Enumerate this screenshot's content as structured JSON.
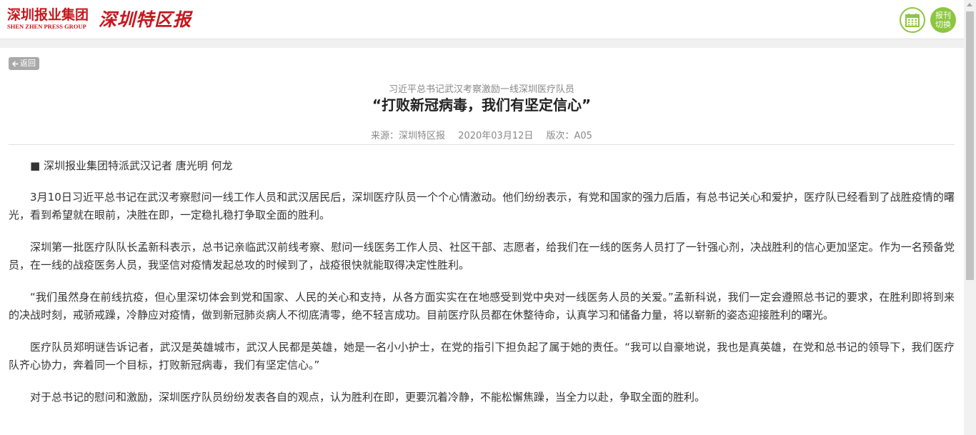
{
  "header": {
    "group_name_cn": "深圳报业集团",
    "group_name_en": "SHEN ZHEN PRESS GROUP",
    "paper_name": "深圳特区报",
    "calendar_icon": "calendar-icon",
    "switch_label_line1": "报刊",
    "switch_label_line2": "切换",
    "accent_color": "#8dc63f",
    "brand_color": "#c8161d"
  },
  "nav": {
    "back_label": "返回",
    "back_icon": "arrow-left-icon"
  },
  "article": {
    "subtitle": "习近平总书记武汉考察激励一线深圳医疗队员",
    "title": "“打败新冠病毒，我们有坚定信心”",
    "source": "来源：深圳特区报",
    "date": "2020年03月12日",
    "edition": "版次：A05",
    "paragraphs": [
      "■ 深圳报业集团特派武汉记者 唐光明 何龙",
      "3月10日习近平总书记在武汉考察慰问一线工作人员和武汉居民后，深圳医疗队员一个个心情激动。他们纷纷表示，有党和国家的强力后盾，有总书记关心和爱护，医疗队已经看到了战胜疫情的曙光，看到希望就在眼前，决胜在即，一定稳扎稳打争取全面的胜利。",
      "深圳第一批医疗队队长孟新科表示，总书记亲临武汉前线考察、慰问一线医务工作人员、社区干部、志愿者，给我们在一线的医务人员打了一针强心剂，决战胜利的信心更加坚定。作为一名预备党员，在一线的战疫医务人员，我坚信对疫情发起总攻的时候到了，战疫很快就能取得决定性胜利。",
      "“我们虽然身在前线抗疫，但心里深切体会到党和国家、人民的关心和支持，从各方面实实在在地感受到党中央对一线医务人员的关爱。”孟新科说，我们一定会遵照总书记的要求，在胜利即将到来的决战时刻，戒骄戒躁，冷静应对疫情，做到新冠肺炎病人不彻底清零，绝不轻言成功。目前医疗队员都在休整待命，认真学习和储备力量，将以崭新的姿态迎接胜利的曙光。",
      "医疗队员郑明谜告诉记者，武汉是英雄城市，武汉人民都是英雄，她是一名小小护士，在党的指引下担负起了属于她的责任。“我可以自豪地说，我也是真英雄，在党和总书记的领导下，我们医疗队齐心协力，奔着同一个目标，打败新冠病毒，我们有坚定信心。”",
      "对于总书记的慰问和激励，深圳医疗队员纷纷发表各自的观点，认为胜利在即，更要沉着冷静，不能松懈焦躁，当全力以赴，争取全面的胜利。"
    ]
  }
}
